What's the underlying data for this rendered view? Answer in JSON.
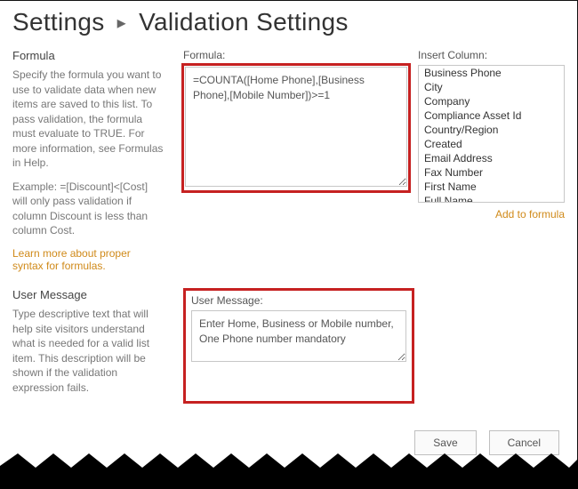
{
  "header": {
    "crumb1": "Settings",
    "crumb2": "Validation Settings"
  },
  "formula": {
    "heading": "Formula",
    "desc1": "Specify the formula you want to use to validate data when new items are saved to this list. To pass validation, the formula must evaluate to TRUE. For more information, see Formulas in Help.",
    "desc2": "Example: =[Discount]<[Cost] will only pass validation if column Discount is less than column Cost.",
    "syntax_link": "Learn more about proper syntax for formulas.",
    "field_label": "Formula:",
    "value_pre": "=",
    "value_func": "COUNTA",
    "value_post": "([Home Phone],[Business Phone],[Mobile Number])>=1",
    "insert_label": "Insert Column:",
    "columns": [
      "Business Phone",
      "City",
      "Company",
      "Compliance Asset Id",
      "Country/Region",
      "Created",
      "Email Address",
      "Fax Number",
      "First Name",
      "Full Name"
    ],
    "add_link": "Add to formula"
  },
  "usermsg": {
    "heading": "User Message",
    "desc": "Type descriptive text that will help site visitors understand what is needed for a valid list item. This description will be shown if the validation expression fails.",
    "field_label": "User Message:",
    "value": "Enter Home, Business or Mobile number, One Phone number mandatory"
  },
  "buttons": {
    "save": "Save",
    "cancel": "Cancel"
  }
}
